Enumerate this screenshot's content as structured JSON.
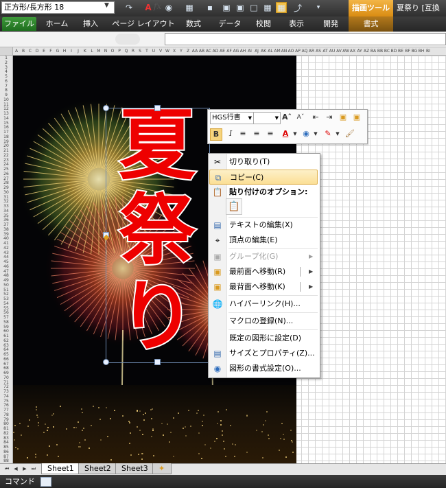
{
  "window": {
    "title": "夏祭り [互換",
    "context_tab_group": "描画ツール"
  },
  "ribbon": {
    "tabs": [
      "ファイル",
      "ホーム",
      "挿入",
      "ページ レイアウト",
      "数式",
      "データ",
      "校閲",
      "表示",
      "開発",
      "書式"
    ],
    "active_tab": "ファイル"
  },
  "formula_bar": {
    "name_box": "正方形/長方形 18",
    "fx_label": "fx",
    "content": ""
  },
  "column_headers": [
    "A",
    "B",
    "C",
    "D",
    "E",
    "F",
    "G",
    "H",
    "I",
    "J",
    "K",
    "L",
    "M",
    "N",
    "O",
    "P",
    "Q",
    "R",
    "S",
    "T",
    "U",
    "V",
    "W",
    "X",
    "Y",
    "Z",
    "AA",
    "AB",
    "AC",
    "AD",
    "AE",
    "AF",
    "AG",
    "AH",
    "AI",
    "AJ",
    "AK",
    "AL",
    "AM",
    "AN",
    "AO",
    "AP",
    "AQ",
    "AR",
    "AS",
    "AT",
    "AU",
    "AV",
    "AW",
    "AX",
    "AY",
    "AZ",
    "BA",
    "BB",
    "BC",
    "BD",
    "BE",
    "BF",
    "BG",
    "BH",
    "BI"
  ],
  "row_count": 88,
  "text_art": {
    "chars": [
      "夏",
      "祭",
      "り"
    ],
    "fill_color": "#ee0000",
    "outline_color": "#ffffff"
  },
  "mini_toolbar": {
    "font_name": "HGS行書",
    "font_size": ""
  },
  "context_menu": {
    "items": [
      {
        "label": "切り取り(T)",
        "icon": "scissors-icon",
        "state": "normal"
      },
      {
        "label": "コピー(C)",
        "icon": "copy-icon",
        "state": "highlighted"
      },
      {
        "label": "貼り付けのオプション:",
        "icon": "paste-icon",
        "state": "header"
      },
      {
        "label": "テキストの編集(X)",
        "icon": "edit-text-icon",
        "state": "normal"
      },
      {
        "label": "頂点の編集(E)",
        "icon": "edit-points-icon",
        "state": "normal"
      },
      {
        "label": "グループ化(G)",
        "icon": "group-icon",
        "state": "disabled",
        "submenu": true
      },
      {
        "label": "最前面へ移動(R)",
        "icon": "bring-front-icon",
        "state": "normal",
        "submenu": true
      },
      {
        "label": "最背面へ移動(K)",
        "icon": "send-back-icon",
        "state": "normal",
        "submenu": true
      },
      {
        "label": "ハイパーリンク(H)...",
        "icon": "hyperlink-icon",
        "state": "normal"
      },
      {
        "label": "マクロの登録(N)...",
        "icon": "",
        "state": "normal"
      },
      {
        "label": "既定の図形に設定(D)",
        "icon": "",
        "state": "normal"
      },
      {
        "label": "サイズとプロパティ(Z)...",
        "icon": "size-properties-icon",
        "state": "normal"
      },
      {
        "label": "図形の書式設定(O)...",
        "icon": "format-shape-icon",
        "state": "normal"
      }
    ]
  },
  "sheets": {
    "tabs": [
      "Sheet1",
      "Sheet2",
      "Sheet3"
    ],
    "active": "Sheet1"
  },
  "status_bar": {
    "mode": "コマンド"
  }
}
